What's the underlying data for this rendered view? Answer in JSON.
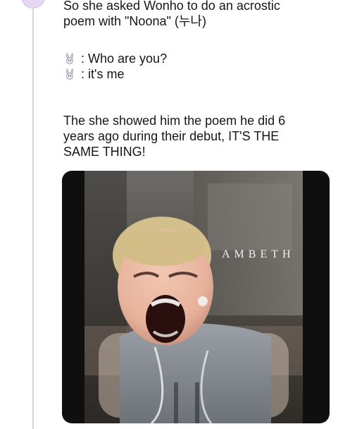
{
  "tweet": {
    "line1": "So she asked Wonho to do an acrostic",
    "line2": "poem with \"Noona\" (누나)",
    "dialog": [
      {
        "icon": "bunny-emoji",
        "text": ": Who are you?"
      },
      {
        "icon": "bunny-emoji",
        "text": ": it's me"
      }
    ],
    "line5": "The she showed him the poem he did 6",
    "line6": "years ago during their debut, IT'S THE",
    "line7": "SAME THING!"
  },
  "media": {
    "sign_text": "AMBETH"
  }
}
